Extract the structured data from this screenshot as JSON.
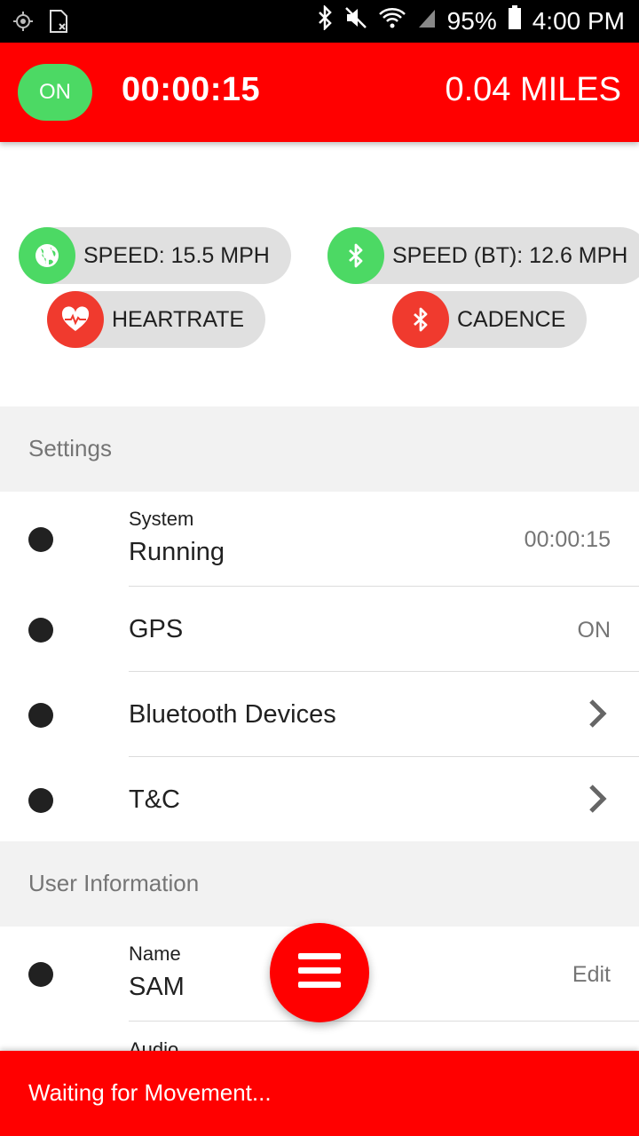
{
  "status_bar": {
    "battery_percent": "95%",
    "time": "4:00 PM",
    "icons": [
      "location-icon",
      "sim-missing-icon",
      "bluetooth-icon",
      "mute-icon",
      "wifi-icon",
      "signal-icon",
      "battery-icon"
    ]
  },
  "header": {
    "toggle_label": "ON",
    "elapsed": "00:00:15",
    "distance": "0.04 MILES",
    "bg_color": "#ff0000"
  },
  "sensors": [
    {
      "label": "SPEED: 15.5 MPH",
      "icon": "globe-icon",
      "status_color": "#4cd964"
    },
    {
      "label": "SPEED (BT): 12.6 MPH",
      "icon": "bluetooth-icon",
      "status_color": "#4cd964"
    },
    {
      "label": "HEARTRATE",
      "icon": "heart-pulse-icon",
      "status_color": "#f03a2e"
    },
    {
      "label": "CADENCE",
      "icon": "bluetooth-icon",
      "status_color": "#f03a2e"
    }
  ],
  "settings": {
    "section_title": "Settings",
    "rows": [
      {
        "subtitle": "System",
        "title": "Running",
        "value": "00:00:15"
      },
      {
        "title": "GPS",
        "value": "ON"
      },
      {
        "title": "Bluetooth Devices",
        "value": "chevron-right-icon"
      },
      {
        "title": "T&C",
        "value": "chevron-right-icon"
      }
    ]
  },
  "user_info": {
    "section_title": "User Information",
    "rows": [
      {
        "subtitle": "Name",
        "title": "SAM",
        "action": "Edit"
      },
      {
        "subtitle": "Audio"
      }
    ]
  },
  "fab": {
    "icon": "menu-icon"
  },
  "bottom_bar": {
    "message": "Waiting for Movement..."
  }
}
